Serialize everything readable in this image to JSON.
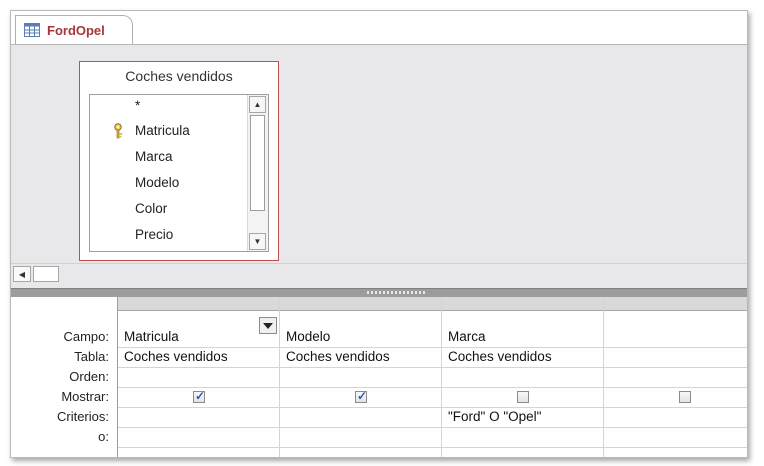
{
  "tab": {
    "title": "FordOpel",
    "icon": "query-design-icon"
  },
  "table": {
    "title": "Coches vendidos",
    "fields": [
      "*",
      "Matricula",
      "Marca",
      "Modelo",
      "Color",
      "Precio"
    ],
    "key_field": "Matricula"
  },
  "grid": {
    "row_labels": [
      "Campo:",
      "Tabla:",
      "Orden:",
      "Mostrar:",
      "Criterios:",
      "o:"
    ],
    "columns": [
      {
        "campo": "Matricula",
        "tabla": "Coches vendidos",
        "orden": "",
        "mostrar": true,
        "criterios": "",
        "o": ""
      },
      {
        "campo": "Modelo",
        "tabla": "Coches vendidos",
        "orden": "",
        "mostrar": true,
        "criterios": "",
        "o": ""
      },
      {
        "campo": "Marca",
        "tabla": "Coches vendidos",
        "orden": "",
        "mostrar": false,
        "criterios": "\"Ford\" O \"Opel\"",
        "o": ""
      },
      {
        "campo": "",
        "tabla": "",
        "orden": "",
        "mostrar": false,
        "criterios": "",
        "o": ""
      }
    ]
  },
  "colors": {
    "tab_text": "#a4373a",
    "table_border": "#c0504d",
    "check": "#2a5dab"
  }
}
